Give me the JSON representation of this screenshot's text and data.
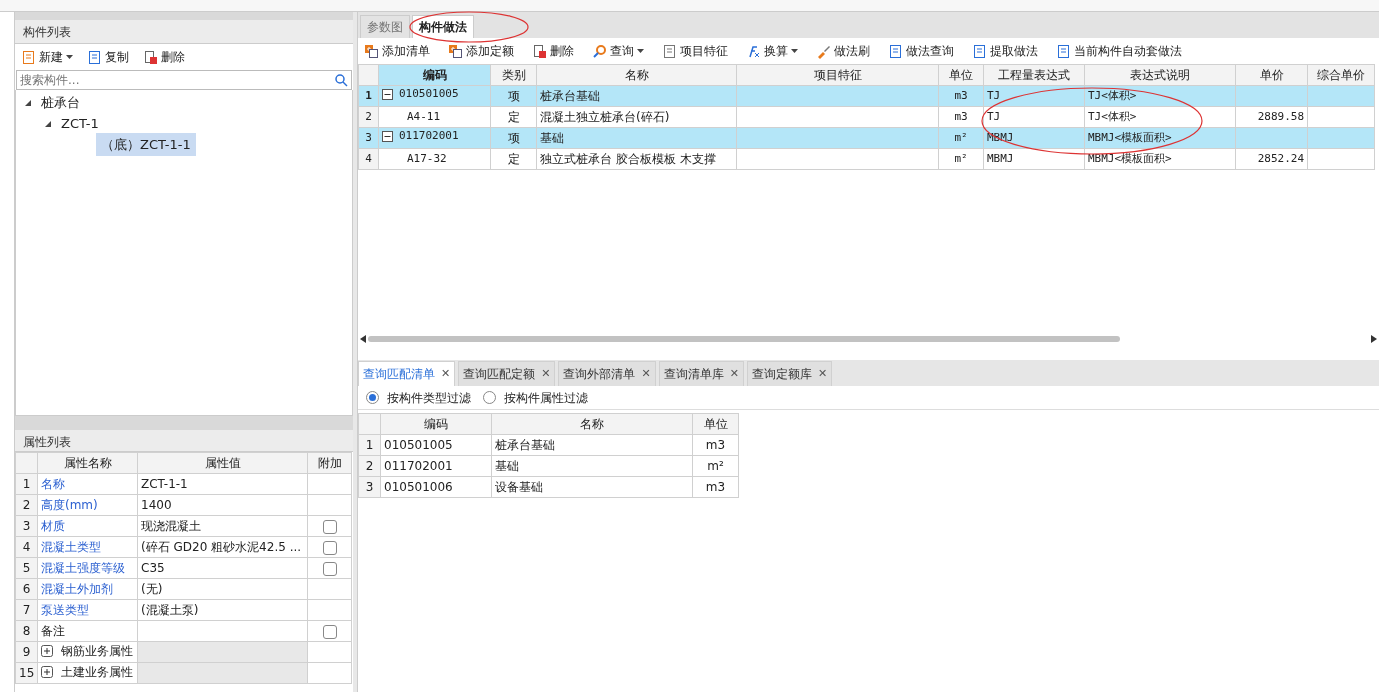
{
  "component_list": {
    "title": "构件列表",
    "toolbar": [
      {
        "label": "新建",
        "dropdown": true
      },
      {
        "label": "复制",
        "dropdown": false
      },
      {
        "label": "删除",
        "dropdown": false
      }
    ],
    "search": {
      "placeholder": "搜索构件..."
    },
    "tree": [
      {
        "label": "桩承台",
        "expanded": true,
        "selected": false,
        "children": [
          {
            "label": "ZCT-1",
            "expanded": true,
            "selected": false,
            "children": [
              {
                "label": "（底）ZCT-1-1",
                "selected": true
              }
            ]
          }
        ]
      }
    ]
  },
  "property_list": {
    "title": "属性列表",
    "columns": [
      "属性名称",
      "属性值",
      "附加"
    ],
    "rows": [
      {
        "num": "1",
        "kind": "linked",
        "name": "名称",
        "value": "ZCT-1-1"
      },
      {
        "num": "2",
        "kind": "linked",
        "name": "高度(mm)",
        "value": "1400"
      },
      {
        "num": "3",
        "kind": "linked",
        "name": "材质",
        "value": "现浇混凝土",
        "attach": {
          "checked": false
        }
      },
      {
        "num": "4",
        "kind": "linked",
        "name": "混凝土类型",
        "value": "(碎石 GD20 粗砂水泥42.5  ...",
        "attach": {
          "checked": false
        }
      },
      {
        "num": "5",
        "kind": "linked",
        "name": "混凝土强度等级",
        "value": "C35",
        "attach": {
          "checked": false
        }
      },
      {
        "num": "6",
        "kind": "linked",
        "name": "混凝土外加剂",
        "value": "(无)"
      },
      {
        "num": "7",
        "kind": "linked",
        "name": "泵送类型",
        "value": "(混凝土泵)"
      },
      {
        "num": "8",
        "kind": "plain",
        "name": "备注",
        "attach": {
          "checked": false
        }
      },
      {
        "num": "9",
        "kind": "group",
        "name": "钢筋业务属性"
      },
      {
        "num": "15",
        "kind": "group",
        "name": "土建业务属性"
      }
    ]
  },
  "tabs": [
    {
      "label": "参数图",
      "selected": false
    },
    {
      "label": "构件做法",
      "selected": true
    }
  ],
  "method_toolbar": [
    {
      "label": "添加清单",
      "dropdown": false
    },
    {
      "label": "添加定额",
      "dropdown": false
    },
    {
      "label": "删除",
      "dropdown": false
    },
    {
      "label": "查询",
      "dropdown": true
    },
    {
      "label": "项目特征",
      "dropdown": false
    },
    {
      "label": "换算",
      "dropdown": true
    },
    {
      "label": "做法刷",
      "dropdown": false
    },
    {
      "label": "做法查询",
      "dropdown": false
    },
    {
      "label": "提取做法",
      "dropdown": false
    },
    {
      "label": "当前构件自动套做法",
      "dropdown": false
    }
  ],
  "method_table": {
    "columns": [
      "编码",
      "类别",
      "名称",
      "项目特征",
      "单位",
      "工程量表达式",
      "表达式说明",
      "单价",
      "综合单价"
    ],
    "rows": [
      {
        "num": "1",
        "kind": "bill",
        "current": true,
        "code": "010501005",
        "category": "项",
        "name": "桩承台基础",
        "unit": "m3",
        "expr": "TJ",
        "expr_desc": "TJ<体积>"
      },
      {
        "num": "2",
        "kind": "quota",
        "current": false,
        "code": "A4-11",
        "category": "定",
        "name": "混凝土独立桩承台(碎石)",
        "unit": "m3",
        "expr": "TJ",
        "expr_desc": "TJ<体积>",
        "price": "2889.58"
      },
      {
        "num": "3",
        "kind": "bill",
        "current": false,
        "code": "011702001",
        "category": "项",
        "name": "基础",
        "unit": "m²",
        "expr": "MBMJ",
        "expr_desc": "MBMJ<模板面积>"
      },
      {
        "num": "4",
        "kind": "quota",
        "current": false,
        "code": "A17-32",
        "category": "定",
        "name": "独立式桩承台 胶合板模板 木支撑",
        "unit": "m²",
        "expr": "MBMJ",
        "expr_desc": "MBMJ<模板面积>",
        "price": "2852.24"
      }
    ]
  },
  "query_tabs": [
    {
      "label": "查询匹配清单",
      "selected": true
    },
    {
      "label": "查询匹配定额",
      "selected": false
    },
    {
      "label": "查询外部清单",
      "selected": false
    },
    {
      "label": "查询清单库",
      "selected": false
    },
    {
      "label": "查询定额库",
      "selected": false
    }
  ],
  "close_glyph": "✕",
  "filters": [
    {
      "label": "按构件类型过滤",
      "selected": true
    },
    {
      "label": "按构件属性过滤",
      "selected": false
    }
  ],
  "match_table": {
    "columns": [
      "编码",
      "名称",
      "单位"
    ],
    "rows": [
      {
        "num": "1",
        "code": "010501005",
        "name": "桩承台基础",
        "unit": "m3"
      },
      {
        "num": "2",
        "code": "011702001",
        "name": "基础",
        "unit": "m²"
      },
      {
        "num": "3",
        "code": "010501006",
        "name": "设备基础",
        "unit": "m3"
      }
    ]
  }
}
